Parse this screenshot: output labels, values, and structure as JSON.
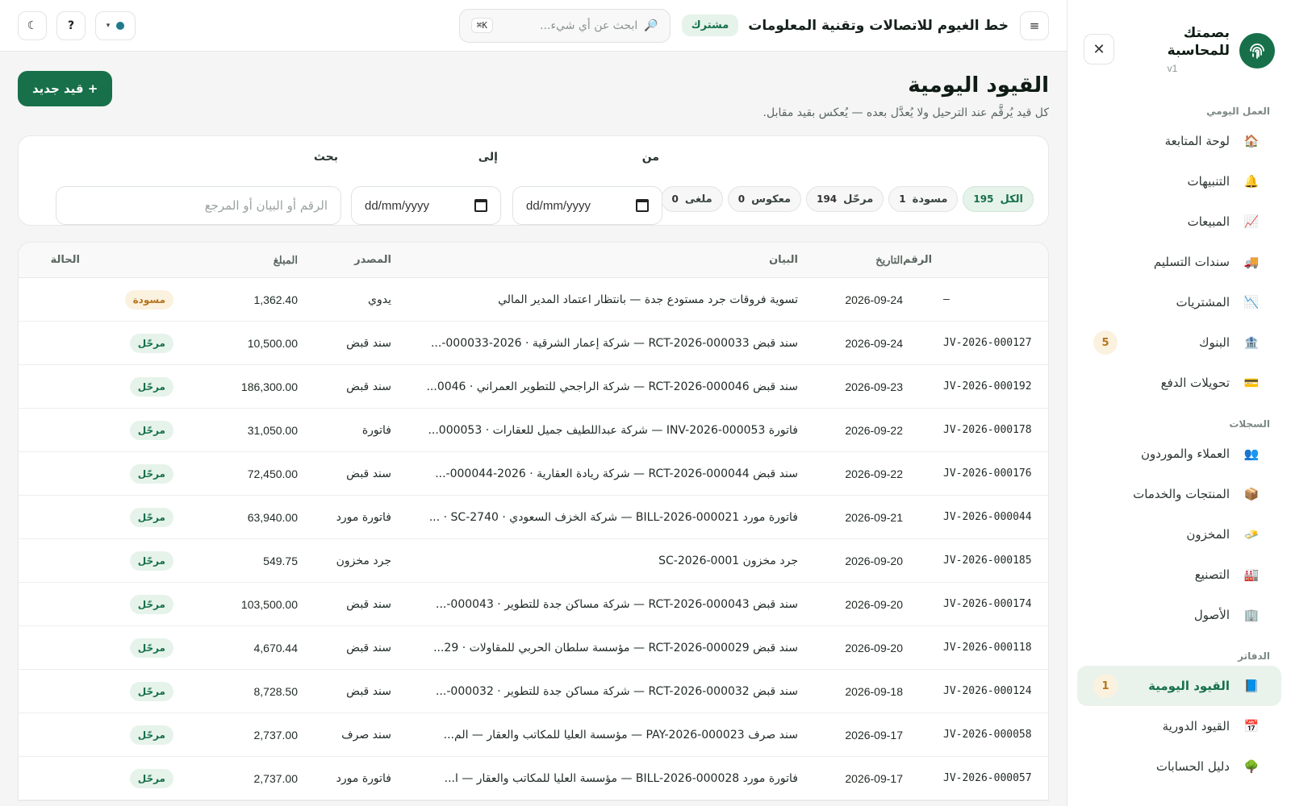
{
  "sidebar": {
    "brand_line1": "بصمتك",
    "brand_line2": "للمحاسبة",
    "version": "v1",
    "sections": {
      "daily": "العمل اليومي",
      "records": "السجلات",
      "books": "الدفاتر"
    },
    "items": [
      {
        "label": "لوحة المتابعة",
        "icon": "🏠"
      },
      {
        "label": "التنبيهات",
        "icon": "🔔"
      },
      {
        "label": "المبيعات",
        "icon": "📈"
      },
      {
        "label": "سندات التسليم",
        "icon": "🚚"
      },
      {
        "label": "المشتريات",
        "icon": "📉"
      },
      {
        "label": "البنوك",
        "icon": "🏦",
        "badge": "5"
      },
      {
        "label": "تحويلات الدفع",
        "icon": "💳"
      },
      {
        "label": "العملاء والموردون",
        "icon": "👥"
      },
      {
        "label": "المنتجات والخدمات",
        "icon": "📦"
      },
      {
        "label": "المخزون",
        "icon": "🧈"
      },
      {
        "label": "التصنيع",
        "icon": "🏭"
      },
      {
        "label": "الأصول",
        "icon": "🏢"
      },
      {
        "label": "القيود اليومية",
        "icon": "📘",
        "badge": "1"
      },
      {
        "label": "القيود الدورية",
        "icon": "📅"
      },
      {
        "label": "دليل الحسابات",
        "icon": "🌳"
      }
    ]
  },
  "topbar": {
    "menu_icon": "≡",
    "company": "خط الغيوم للاتصالات وتقنية المعلومات",
    "tag": "مشترك",
    "search_placeholder": "ابحث عن أي شيء...",
    "search_icon": "🔎",
    "shortcut": "K⌘",
    "help": "?",
    "theme_icon": "☾",
    "caret": "▾"
  },
  "page": {
    "title": "القيود اليومية",
    "subtitle": "كل قيد يُرقَّم عند الترحيل ولا يُعدَّل بعده — يُعكس بقيد مقابل.",
    "new_button": "+ قيد جديد"
  },
  "filters": {
    "chips": [
      {
        "label": "الكل",
        "count": "195"
      },
      {
        "label": "مسودة",
        "count": "1"
      },
      {
        "label": "مرحّل",
        "count": "194"
      },
      {
        "label": "معكوس",
        "count": "0"
      },
      {
        "label": "ملغى",
        "count": "0"
      }
    ],
    "from_label": "من",
    "to_label": "إلى",
    "search_label": "بحث",
    "date_placeholder": "dd/mm/yyyy",
    "search_placeholder": "الرقم أو البيان أو المرجع"
  },
  "table": {
    "headers": {
      "number": "الرقم",
      "date": "التاريخ",
      "description": "البيان",
      "source": "المصدر",
      "amount": "المبلغ",
      "status": "الحالة"
    },
    "rows": [
      {
        "number": "—",
        "date": "2026-09-24",
        "description": "تسوية فروقات جرد مستودع جدة — بانتظار اعتماد المدير المالي",
        "source": "يدوي",
        "amount": "1,362.40",
        "status": "مسودة",
        "kind": "draft"
      },
      {
        "number": "JV-2026-000127",
        "date": "2026-09-24",
        "description": "سند قبض RCT-2026-000033 — شركة إعمار الشرقية · 2026-000033-...",
        "source": "سند قبض",
        "amount": "10,500.00",
        "status": "مرحّل",
        "kind": "posted"
      },
      {
        "number": "JV-2026-000192",
        "date": "2026-09-23",
        "description": "سند قبض RCT-2026-000046 — شركة الراجحي للتطوير العمراني · 0046...",
        "source": "سند قبض",
        "amount": "186,300.00",
        "status": "مرحّل",
        "kind": "posted"
      },
      {
        "number": "JV-2026-000178",
        "date": "2026-09-22",
        "description": "فاتورة INV-2026-000053 — شركة عبداللطيف جميل للعقارات · 000053...",
        "source": "فاتورة",
        "amount": "31,050.00",
        "status": "مرحّل",
        "kind": "posted"
      },
      {
        "number": "JV-2026-000176",
        "date": "2026-09-22",
        "description": "سند قبض RCT-2026-000044 — شركة ريادة العقارية · 2026-000044-...",
        "source": "سند قبض",
        "amount": "72,450.00",
        "status": "مرحّل",
        "kind": "posted"
      },
      {
        "number": "JV-2026-000044",
        "date": "2026-09-21",
        "description": "فاتورة مورد BILL-2026-000021 — شركة الخزف السعودي · SC-2740 · ...",
        "source": "فاتورة مورد",
        "amount": "63,940.00",
        "status": "مرحّل",
        "kind": "posted"
      },
      {
        "number": "JV-2026-000185",
        "date": "2026-09-20",
        "description": "جرد مخزون SC-2026-0001",
        "source": "جرد مخزون",
        "amount": "549.75",
        "status": "مرحّل",
        "kind": "posted"
      },
      {
        "number": "JV-2026-000174",
        "date": "2026-09-20",
        "description": "سند قبض RCT-2026-000043 — شركة مساكن جدة للتطوير · 000043-...",
        "source": "سند قبض",
        "amount": "103,500.00",
        "status": "مرحّل",
        "kind": "posted"
      },
      {
        "number": "JV-2026-000118",
        "date": "2026-09-20",
        "description": "سند قبض RCT-2026-000029 — مؤسسة سلطان الحربي للمقاولات · 29...",
        "source": "سند قبض",
        "amount": "4,670.44",
        "status": "مرحّل",
        "kind": "posted"
      },
      {
        "number": "JV-2026-000124",
        "date": "2026-09-18",
        "description": "سند قبض RCT-2026-000032 — شركة مساكن جدة للتطوير · 000032-...",
        "source": "سند قبض",
        "amount": "8,728.50",
        "status": "مرحّل",
        "kind": "posted"
      },
      {
        "number": "JV-2026-000058",
        "date": "2026-09-17",
        "description": "سند صرف PAY-2026-000023 — مؤسسة العليا للمكاتب والعقار — الم...",
        "source": "سند صرف",
        "amount": "2,737.00",
        "status": "مرحّل",
        "kind": "posted"
      },
      {
        "number": "JV-2026-000057",
        "date": "2026-09-17",
        "description": "فاتورة مورد BILL-2026-000028 — مؤسسة العليا للمكاتب والعقار — ا...",
        "source": "فاتورة مورد",
        "amount": "2,737.00",
        "status": "مرحّل",
        "kind": "posted"
      }
    ]
  },
  "colors": {
    "brand": "#17704a",
    "posted_bg": "#e6f3ea",
    "draft_bg": "#fbf1df",
    "draft_text": "#b5751a"
  }
}
